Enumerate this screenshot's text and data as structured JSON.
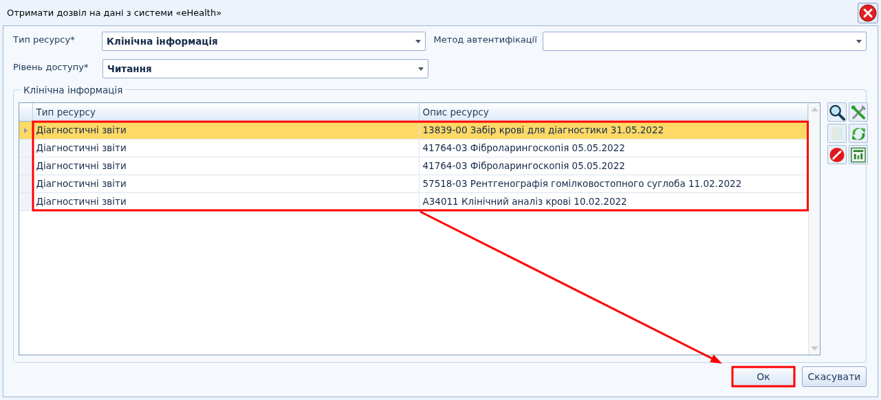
{
  "window": {
    "title": "Отримати дозвіл на дані з системи «eHealth»"
  },
  "fields": [
    {
      "label": "Тип ресурсу*",
      "value": "Клінічна інформація"
    },
    {
      "label": "Метод автентифікації"
    },
    {
      "label": "Рівень доступу*",
      "value": "Читання"
    }
  ],
  "group": {
    "title": "Клінічна інформація"
  },
  "table": {
    "columns": [
      "Тип ресурсу",
      "Опис ресурсу"
    ],
    "rows": [
      {
        "type": "Діагностичні звіти",
        "description": "13839-00 Забір крові для діагностики 31.05.2022",
        "selected": true
      },
      {
        "type": "Діагностичні звіти",
        "description": "41764-03 Фіброларингоскопія 05.05.2022",
        "selected": false
      },
      {
        "type": "Діагностичні звіти",
        "description": "41764-03 Фіброларингоскопія 05.05.2022",
        "selected": false
      },
      {
        "type": "Діагностичні звіти",
        "description": "57518-03 Рентгенографія гомілковостопного суглоба 11.02.2022",
        "selected": false
      },
      {
        "type": "Діагностичні звіти",
        "description": "A34011 Клінічний аналіз крові 10.02.2022",
        "selected": false
      }
    ]
  },
  "tools": [
    {
      "kind": "search",
      "disabled": false
    },
    {
      "kind": "tools",
      "disabled": false
    },
    {
      "kind": "book",
      "disabled": true
    },
    {
      "kind": "refresh",
      "disabled": false
    },
    {
      "kind": "delete",
      "disabled": false
    },
    {
      "kind": "grid",
      "disabled": false
    }
  ],
  "buttons": [
    {
      "label": "Ок"
    },
    {
      "label": "Скасувати"
    }
  ],
  "annotation": {
    "rows_framed": true,
    "button_framed": true,
    "arrow": true
  }
}
